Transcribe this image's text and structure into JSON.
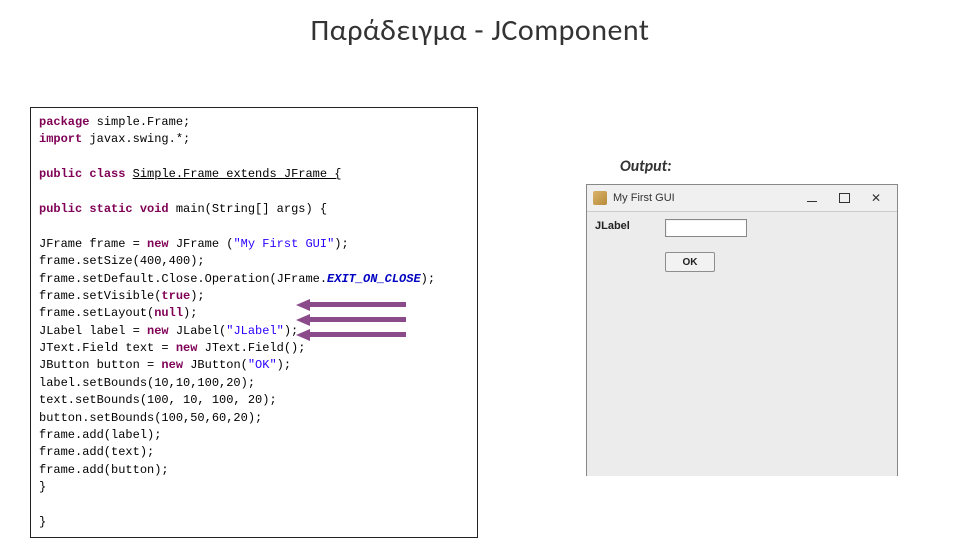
{
  "title": "Παράδειγμα - JComponent",
  "code": {
    "l01a": "package",
    "l01b": " simple.Frame;",
    "l02a": "import",
    "l02b": " javax.swing.*;",
    "l04a": "public",
    "l04b": " class ",
    "l04c": "Simple.Frame extends JFrame {",
    "l06a": "public",
    "l06b": " static void ",
    "l06c": "main(String[] args) {",
    "l08a": "JFrame frame = ",
    "l08b": "new",
    "l08c": " JFrame (",
    "l08d": "\"My First GUI\"",
    "l08e": ");",
    "l09": "frame.setSize(400,400);",
    "l10a": "frame.setDefault.Close.Operation(JFrame.",
    "l10b": "EXIT_ON_CLOSE",
    "l10c": ");",
    "l11a": "frame.setVisible(",
    "l11b": "true",
    "l11c": ");",
    "l12a": "frame.setLayout(",
    "l12b": "null",
    "l12c": ");",
    "l13a": "JLabel label = ",
    "l13b": "new",
    "l13c": " JLabel(",
    "l13d": "\"JLabel\"",
    "l13e": ");",
    "l14a": "JText.Field text = ",
    "l14b": "new",
    "l14c": " JText.Field();",
    "l15a": "JButton button = ",
    "l15b": "new",
    "l15c": " JButton(",
    "l15d": "\"OK\"",
    "l15e": ");",
    "l16": "label.setBounds(10,10,100,20);",
    "l17": "text.setBounds(100, 10, 100, 20);",
    "l18": "button.setBounds(100,50,60,20);",
    "l19": "frame.add(label);",
    "l20": "frame.add(text);",
    "l21": "frame.add(button);",
    "l22": "}",
    "l24": "}"
  },
  "output": {
    "label": "Output:",
    "window": {
      "title": "My First GUI",
      "jlabel": "JLabel",
      "jtext_value": "",
      "jbutton": "OK"
    }
  }
}
